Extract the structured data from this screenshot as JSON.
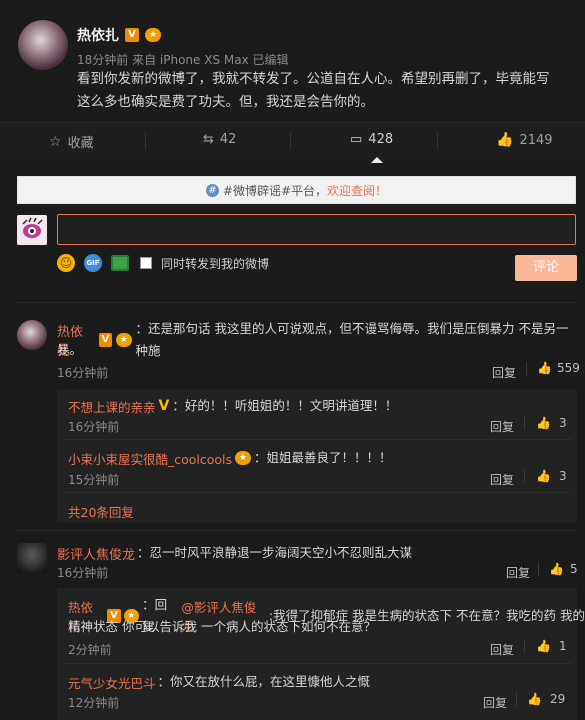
{
  "post": {
    "author": "热依扎",
    "v_badge": "V",
    "meta": "18分钟前 来自 iPhone XS Max  已编辑",
    "text_line1": "看到你发新的微博了，我就不转发了。公道自在人心。希望别再删了，毕竟能写",
    "text_line2": "这么多也确实是费了功夫。但，我还是会告你的。"
  },
  "actions": {
    "favorite_label": "收藏",
    "repost_count": "42",
    "comment_count": "428",
    "like_count": "2149"
  },
  "notice": {
    "prefix": "#微博辟谣#平台，",
    "link": "欢迎查阅！"
  },
  "composer": {
    "placeholder": "",
    "repost_checkbox_label": "同时转发到我的微博",
    "submit_label": "评论"
  },
  "comments": [
    {
      "author": "热依扎",
      "text_line1": "：还是那句话 我这里的人可说观点，但不谩骂侮辱。我们是压倒暴力 不是另一种施",
      "text_line2": "暴。",
      "time": "16分钟前",
      "reply_label": "回复",
      "likes": "559",
      "replies": [
        {
          "author": "不想上课的亲亲",
          "badge": "V",
          "text": "：好的！！听姐姐的！！文明讲道理！！",
          "time": "16分钟前",
          "reply_label": "回复",
          "likes": "3"
        },
        {
          "author": "小束小束屋实很酷_coolcools",
          "text": "：姐姐最善良了！！！！",
          "time": "15分钟前",
          "reply_label": "回复",
          "likes": "3"
        }
      ],
      "more_label": "共20条回复"
    },
    {
      "author": "影评人焦俊龙",
      "text": "：忍一时风平浪静退一步海阔天空小不忍则乱大谋",
      "time": "16分钟前",
      "reply_label": "回复",
      "likes": "5",
      "replies": [
        {
          "author": "热依扎",
          "badge": "V",
          "reply_prefix": "：回复",
          "reply_to": "@影评人焦俊龙",
          "text_line1": ":我得了抑郁症 我是生病的状态下 不在意？我吃的药 我的",
          "text_line2": "精神状态 你可以告诉我 一个病人的状态下如何不在意？",
          "time": "2分钟前",
          "reply_label": "回复",
          "likes": "1"
        },
        {
          "author": "元气少女光巴斗",
          "text": "：你又在放什么屁，在这里慷他人之慨",
          "time": "12分钟前",
          "reply_label": "回复",
          "likes": "29"
        }
      ]
    }
  ]
}
